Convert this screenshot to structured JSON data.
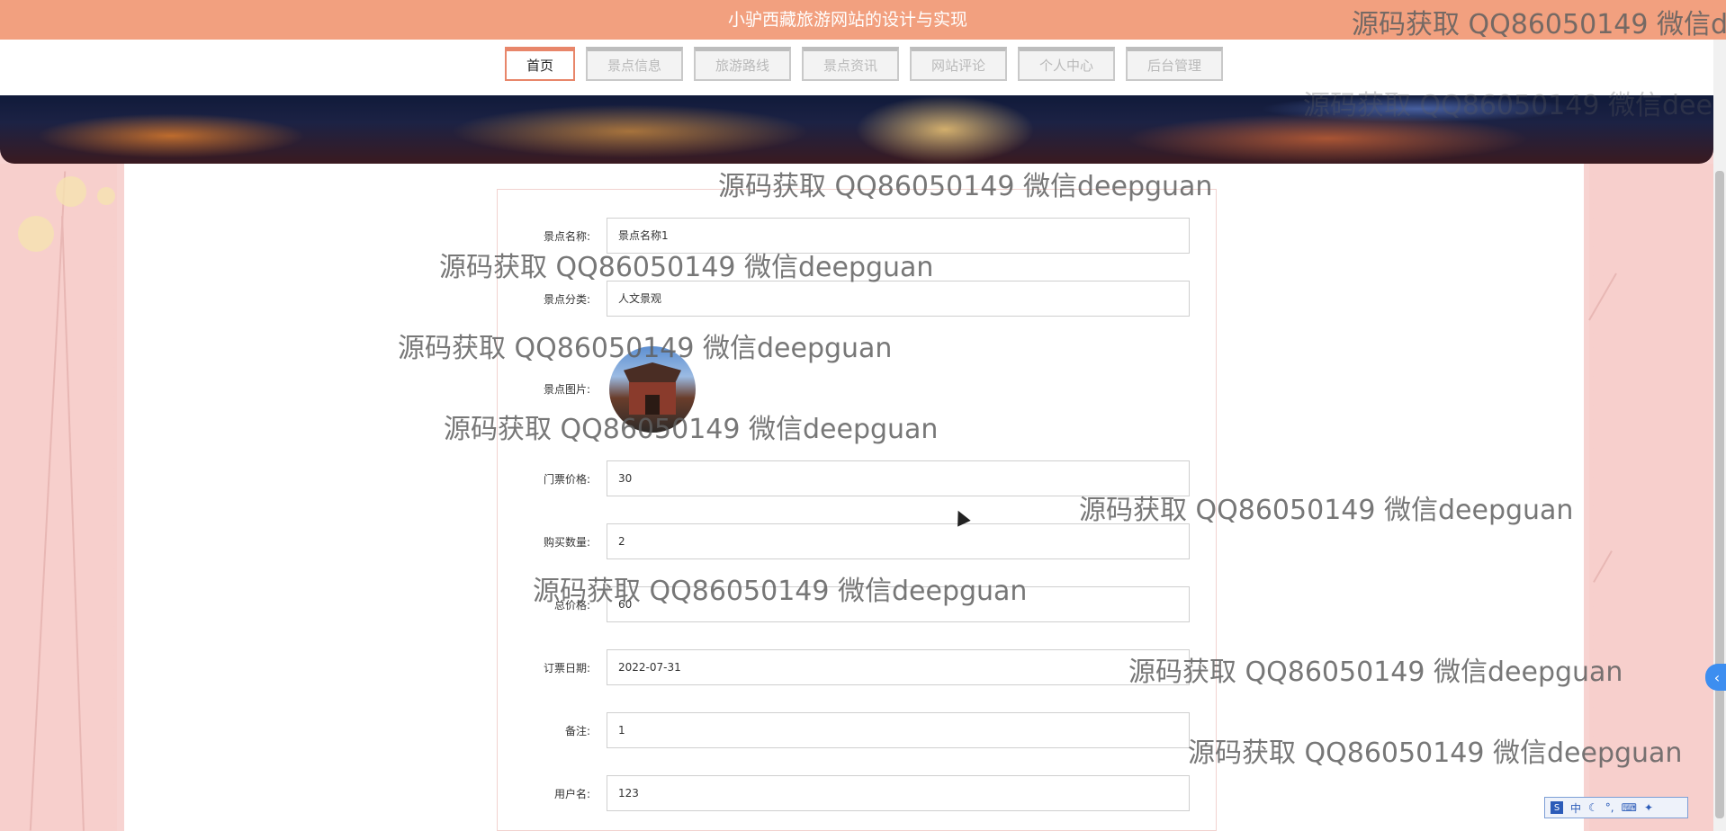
{
  "site": {
    "title": "小驴西藏旅游网站的设计与实现"
  },
  "nav": {
    "items": [
      {
        "label": "首页",
        "active": true
      },
      {
        "label": "景点信息",
        "active": false
      },
      {
        "label": "旅游路线",
        "active": false
      },
      {
        "label": "景点资讯",
        "active": false
      },
      {
        "label": "网站评论",
        "active": false
      },
      {
        "label": "个人中心",
        "active": false
      },
      {
        "label": "后台管理",
        "active": false
      }
    ]
  },
  "form": {
    "spot_name": {
      "label": "景点名称:",
      "value": "景点名称1"
    },
    "spot_category": {
      "label": "景点分类:",
      "value": "人文景观"
    },
    "spot_image": {
      "label": "景点图片:"
    },
    "ticket_price": {
      "label": "门票价格:",
      "value": "30"
    },
    "quantity": {
      "label": "购买数量:",
      "value": "2"
    },
    "total_price": {
      "label": "总价格:",
      "value": "60"
    },
    "order_date": {
      "label": "订票日期:",
      "value": "2022-07-31"
    },
    "remarks": {
      "label": "备注:",
      "value": "1"
    },
    "username": {
      "label": "用户名:",
      "value": "123"
    }
  },
  "watermark": {
    "text": "源码获取 QQ86050149 微信deepguan",
    "text_top_right": "源码获取 QQ86050149 微信de"
  },
  "side_button": {
    "icon": "chevron-left-icon",
    "label": "‹"
  },
  "ime": {
    "label": "中",
    "icons": [
      "moon-icon",
      "dots-icon",
      "keyboard-icon",
      "settings-icon"
    ]
  },
  "colors": {
    "header": "#f2a07f",
    "active_border": "#e8866a",
    "side": "#f7cfcc"
  }
}
